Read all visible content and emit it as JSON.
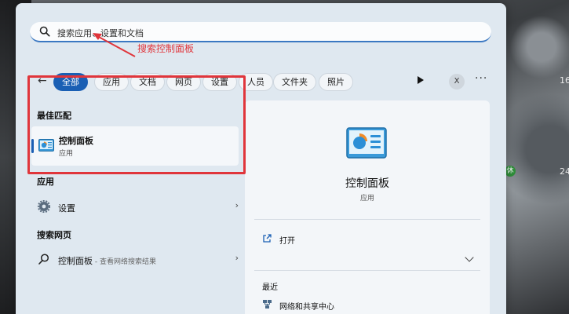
{
  "search": {
    "placeholder": "搜索应用、设置和文档"
  },
  "tabs": [
    {
      "label": "全部",
      "active": true
    },
    {
      "label": "应用"
    },
    {
      "label": "文档"
    },
    {
      "label": "网页"
    },
    {
      "label": "设置"
    },
    {
      "label": "人员"
    },
    {
      "label": "文件夹"
    },
    {
      "label": "照片"
    }
  ],
  "toolbar": {
    "avatar": "X",
    "more": "···"
  },
  "best_match": {
    "section_title": "最佳匹配",
    "title": "控制面板",
    "subtitle": "应用"
  },
  "apps": {
    "section_title": "应用",
    "items": [
      {
        "label": "设置"
      }
    ]
  },
  "web": {
    "section_title": "搜索网页",
    "items": [
      {
        "label": "控制面板",
        "sub": " - 查看网络搜索结果"
      }
    ]
  },
  "detail": {
    "title": "控制面板",
    "subtitle": "应用",
    "open_label": "打开",
    "recent_title": "最近",
    "recent_items": [
      {
        "label": "网络和共享中心"
      }
    ]
  },
  "annotation": {
    "label": "搜索控制面板",
    "color": "#e0353b"
  },
  "desktop": {
    "text_1": "16",
    "text_2": "24",
    "badge": "休"
  },
  "colors": {
    "accent": "#1a5fb4",
    "panel_bg": "#dfe8f0"
  }
}
